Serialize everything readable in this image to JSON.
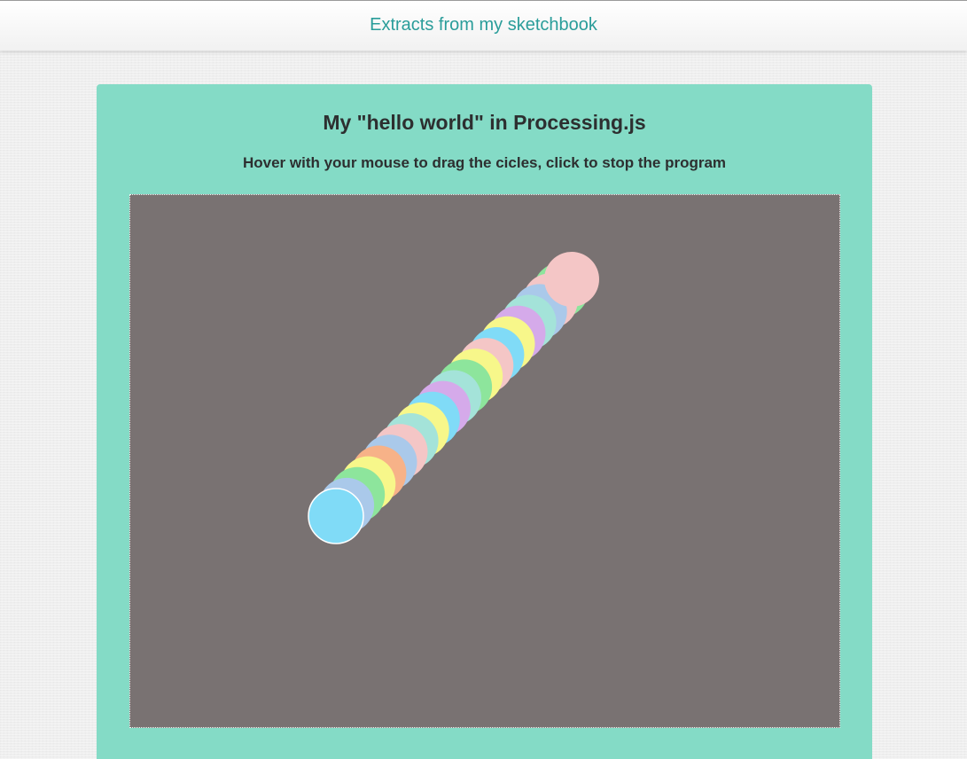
{
  "navbar": {
    "brand": "Extracts from my sketchbook"
  },
  "card": {
    "title": "My \"hello world\" in Processing.js",
    "subtitle": "Hover with your mouse to drag the cicles, click to stop the program"
  },
  "sketch": {
    "background_color": "#797272",
    "circle_trail": [
      {
        "color": "#f4c6c6"
      },
      {
        "color": "#8de59c"
      },
      {
        "color": "#f4c6c6"
      },
      {
        "color": "#aac9ea"
      },
      {
        "color": "#a4e3d9"
      },
      {
        "color": "#d5aaea"
      },
      {
        "color": "#f7f78a"
      },
      {
        "color": "#80dbf7"
      },
      {
        "color": "#f4c6c6"
      },
      {
        "color": "#f7f78a"
      },
      {
        "color": "#8de59c"
      },
      {
        "color": "#a4e3d9"
      },
      {
        "color": "#d5aaea"
      },
      {
        "color": "#80dbf7"
      },
      {
        "color": "#f7f78a"
      },
      {
        "color": "#a4e3d9"
      },
      {
        "color": "#f4c6c6"
      },
      {
        "color": "#aac9ea"
      },
      {
        "color": "#f7b288"
      },
      {
        "color": "#f7f78a"
      },
      {
        "color": "#8de59c"
      },
      {
        "color": "#aac9ea"
      },
      {
        "color": "#80dbf7"
      }
    ],
    "head_outline_color": "#ffffff"
  }
}
